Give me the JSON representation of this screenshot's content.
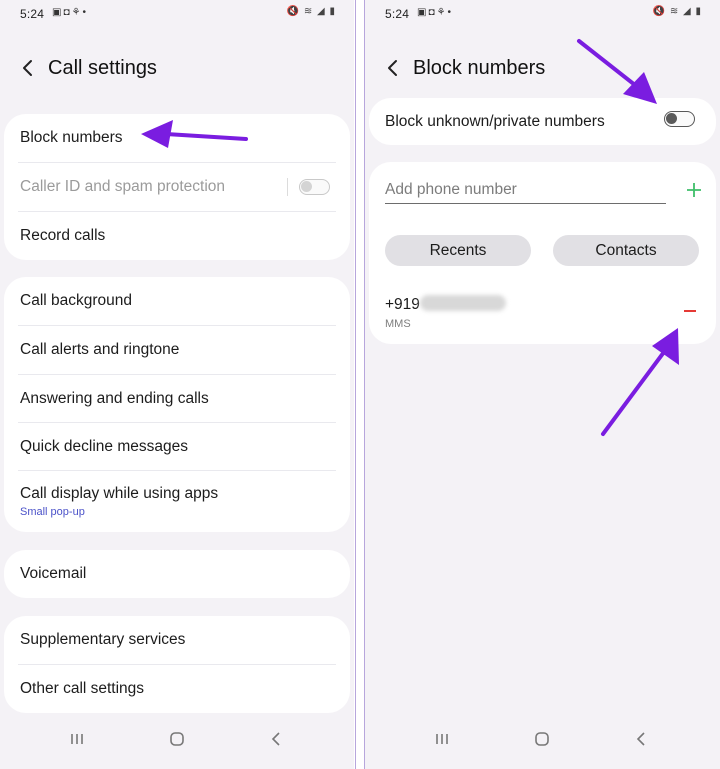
{
  "left": {
    "status": {
      "time": "5:24"
    },
    "header": {
      "title": "Call settings"
    },
    "groups": [
      {
        "items": [
          {
            "label": "Block numbers"
          },
          {
            "label": "Caller ID and spam protection",
            "disabled": true,
            "toggle": "off"
          },
          {
            "label": "Record calls"
          }
        ]
      },
      {
        "items": [
          {
            "label": "Call background"
          },
          {
            "label": "Call alerts and ringtone"
          },
          {
            "label": "Answering and ending calls"
          },
          {
            "label": "Quick decline messages"
          },
          {
            "label": "Call display while using apps",
            "sub": "Small pop-up"
          }
        ]
      },
      {
        "items": [
          {
            "label": "Voicemail"
          }
        ]
      },
      {
        "items": [
          {
            "label": "Supplementary services"
          },
          {
            "label": "Other call settings"
          }
        ]
      }
    ]
  },
  "right": {
    "status": {
      "time": "5:24"
    },
    "header": {
      "title": "Block numbers"
    },
    "block_unknown": {
      "label": "Block unknown/private numbers",
      "toggle": "off"
    },
    "add_field": {
      "placeholder": "Add phone number"
    },
    "buttons": {
      "recents": "Recents",
      "contacts": "Contacts"
    },
    "blocked": [
      {
        "number_prefix": "+919",
        "type": "MMS"
      }
    ]
  },
  "colors": {
    "accent_arrow": "#7a1de0",
    "add": "#3fbf6a",
    "remove": "#e53935",
    "sub_text": "#4b52c9"
  },
  "icons": [
    "back-icon",
    "plus-icon",
    "minus-icon",
    "nav-recents-icon",
    "nav-home-icon",
    "nav-back-icon"
  ]
}
